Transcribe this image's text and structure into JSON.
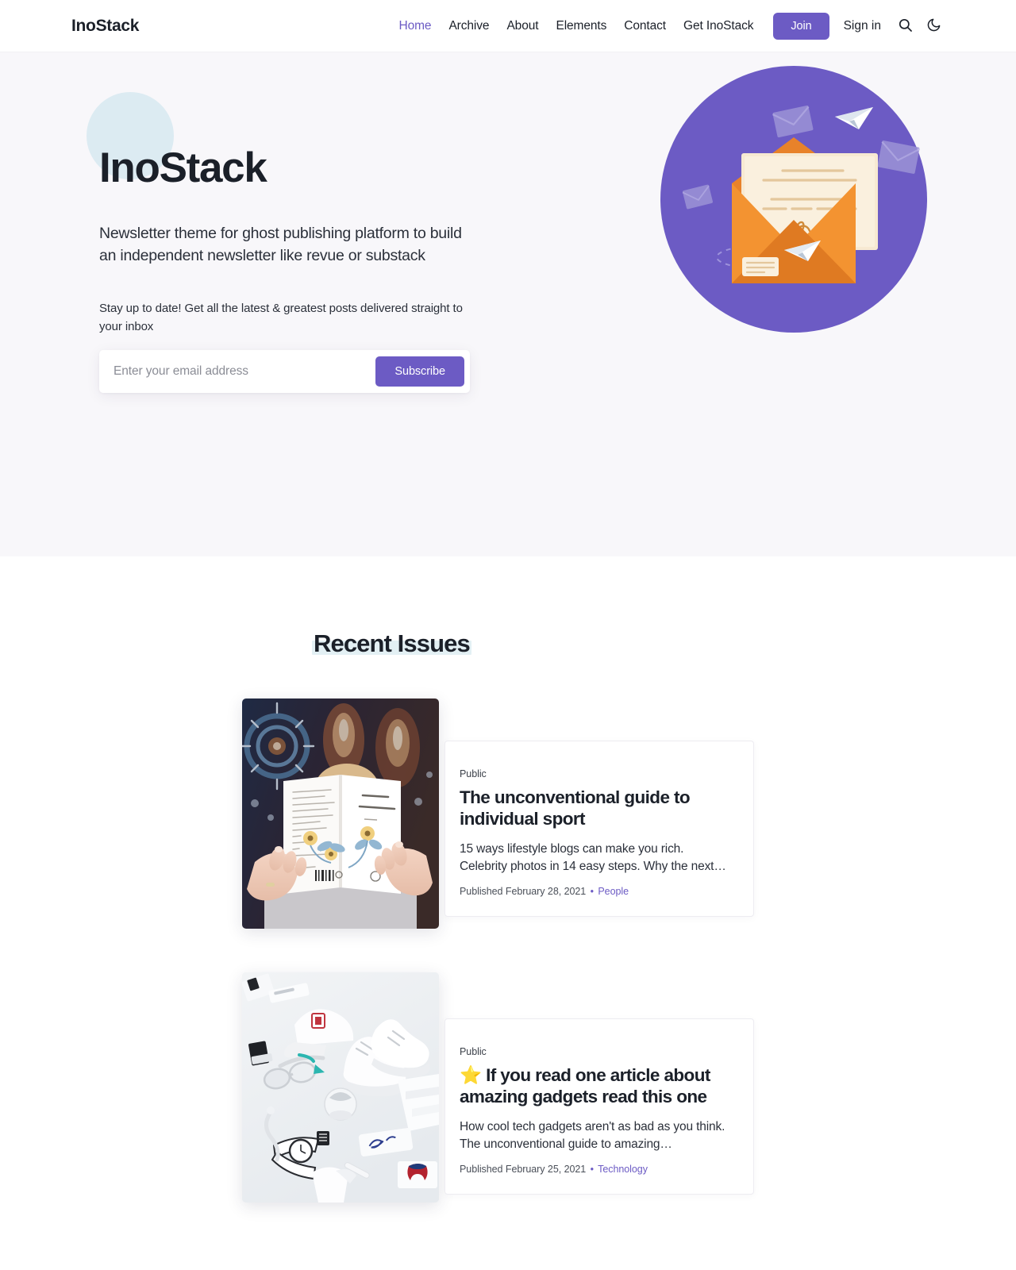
{
  "header": {
    "brand": "InoStack",
    "nav": [
      {
        "label": "Home",
        "active": true
      },
      {
        "label": "Archive",
        "active": false
      },
      {
        "label": "About",
        "active": false
      },
      {
        "label": "Elements",
        "active": false
      },
      {
        "label": "Contact",
        "active": false
      },
      {
        "label": "Get InoStack",
        "active": false
      }
    ],
    "join_label": "Join",
    "signin_label": "Sign in",
    "search_icon": "search-icon",
    "darkmode_icon": "moon-icon"
  },
  "hero": {
    "title": "InoStack",
    "subtitle": "Newsletter theme for ghost publishing platform to build an independent newsletter like revue or substack",
    "cta_text": "Stay up to date! Get all the latest & greatest posts delivered straight to your inbox",
    "email_placeholder": "Enter your email address",
    "email_value": "",
    "subscribe_label": "Subscribe",
    "illustration": "open-envelope-newsletter-illustration"
  },
  "section": {
    "title": "Recent Issues"
  },
  "posts": [
    {
      "visibility": "Public",
      "title": "The unconventional guide to individual sport",
      "star": "",
      "excerpt": "15 ways lifestyle blogs can make you rich. Celebrity photos in 14 easy steps. Why the next…",
      "published": "Published February 28, 2021",
      "dot": "•",
      "tag": "People",
      "thumb": "hands-holding-book-mandala-tapestry"
    },
    {
      "visibility": "Public",
      "title": "If you read one article about amazing gadgets read this one",
      "star": "⭐",
      "excerpt": "How cool tech gadgets aren't as bad as you think. The unconventional guide to amazing…",
      "published": "Published February 25, 2021",
      "dot": "•",
      "tag": "Technology",
      "thumb": "white-fashion-tech-flatlay"
    }
  ],
  "colors": {
    "accent": "#6c5bc4",
    "hero_bg": "#f8f7fa",
    "text": "#1b2029",
    "blob": "#dcebf2",
    "highlight": "#e3f0f4",
    "envelope_orange": "#e8822a",
    "envelope_circle": "#6c5bc4"
  }
}
